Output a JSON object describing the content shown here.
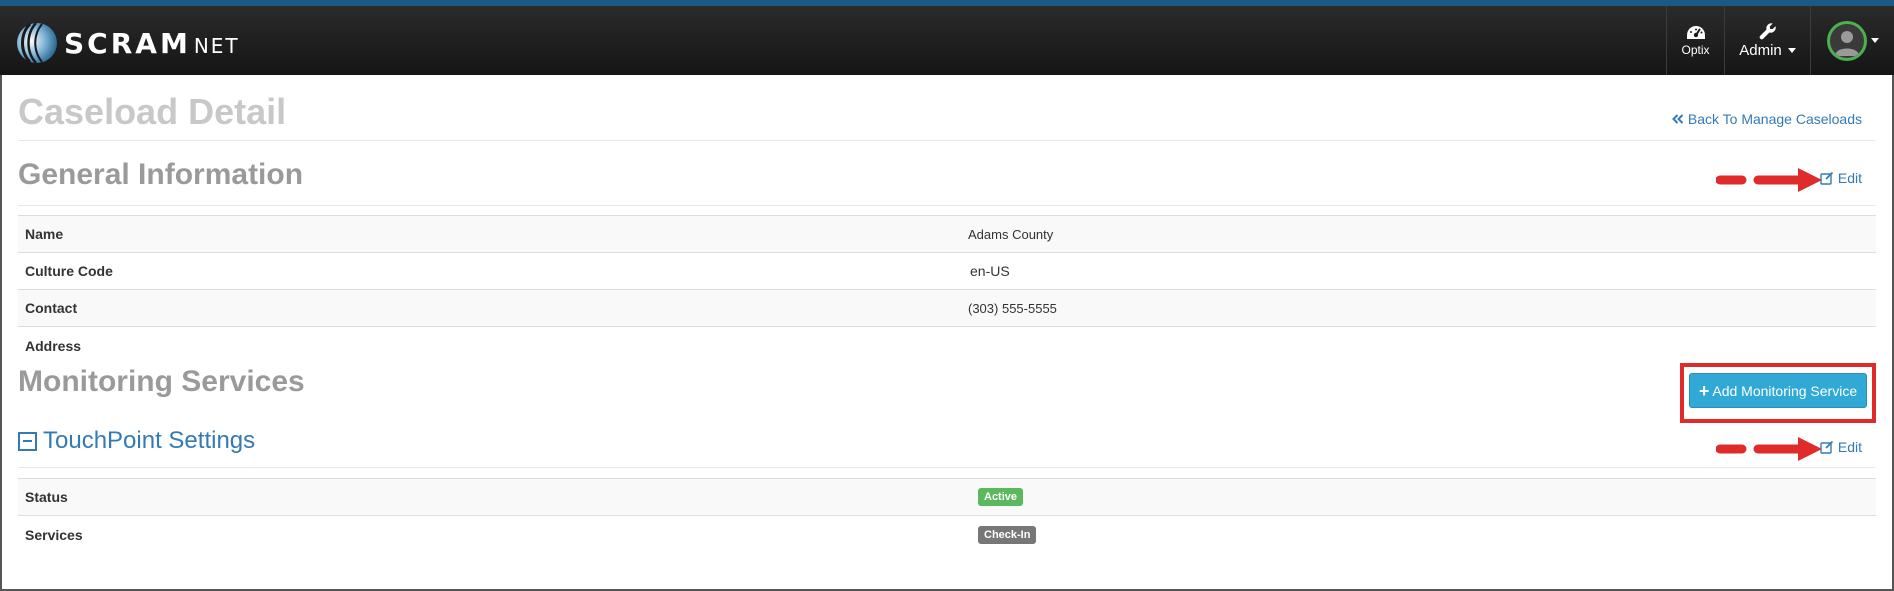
{
  "brand": {
    "main": "SCRAM",
    "sub": "NET"
  },
  "nav": {
    "optix_label": "Optix",
    "admin_label": "Admin"
  },
  "page": {
    "title": "Caseload Detail",
    "back_link": "Back To Manage Caseloads"
  },
  "general": {
    "title": "General Information",
    "edit_label": "Edit",
    "rows": [
      {
        "label": "Name",
        "value": "Adams County"
      },
      {
        "label": "Culture Code",
        "value": "en-US"
      },
      {
        "label": "Contact",
        "value": "(303) 555-5555"
      },
      {
        "label": "Address",
        "value": ""
      }
    ]
  },
  "monitoring": {
    "title": "Monitoring Services",
    "add_button": "Add Monitoring Service"
  },
  "touchpoint": {
    "title": "TouchPoint Settings",
    "edit_label": "Edit",
    "status_label": "Status",
    "status_value": "Active",
    "services_label": "Services",
    "services_value": "Check-In"
  },
  "colors": {
    "accent": "#337ab7",
    "navbar": "#1c1c1c",
    "annotation": "#e02b2b",
    "active_badge": "#5cb85c",
    "checkin_badge": "#777777",
    "add_button": "#31a9d6"
  },
  "icons": {
    "optix": "gauge-icon",
    "admin": "wrench-icon",
    "user": "user-avatar-icon",
    "back": "double-chevron-left-icon",
    "edit": "edit-icon",
    "add": "plus-icon",
    "collapse": "minus-square-icon"
  }
}
